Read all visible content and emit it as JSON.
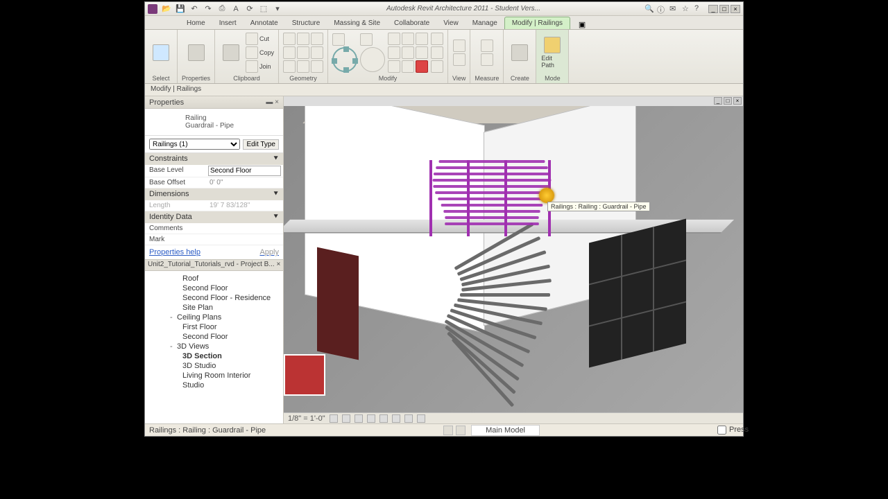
{
  "title": "Autodesk Revit Architecture 2011 - Student Vers...",
  "tabs": [
    "Home",
    "Insert",
    "Annotate",
    "Structure",
    "Massing & Site",
    "Collaborate",
    "View",
    "Manage",
    "Modify | Railings"
  ],
  "active_tab": 8,
  "ribbon": {
    "select": "Select",
    "properties": "Properties",
    "clipboard": "Clipboard",
    "clip_cut": "Cut",
    "clip_copy": "Copy",
    "clip_join": "Join",
    "geometry": "Geometry",
    "modify": "Modify",
    "view": "View",
    "measure": "Measure",
    "create": "Create",
    "mode": "Mode",
    "edit_path": "Edit Path"
  },
  "options_bar": "Modify | Railings",
  "properties": {
    "title": "Properties",
    "type1": "Railing",
    "type2": "Guardrail - Pipe",
    "filter": "Railings (1)",
    "edit_type": "Edit Type",
    "groups": {
      "constraints": "Constraints",
      "dimensions": "Dimensions",
      "identity": "Identity Data"
    },
    "base_level_k": "Base Level",
    "base_level_v": "Second Floor",
    "base_offset_k": "Base Offset",
    "base_offset_v": "0' 0\"",
    "length_k": "Length",
    "length_v": "19' 7 83/128\"",
    "comments_k": "Comments",
    "mark_k": "Mark",
    "help": "Properties help",
    "apply": "Apply"
  },
  "browser": {
    "title": "Unit2_Tutorial_Tutorials_rvd - Project B... ×",
    "items": [
      {
        "lvl": 2,
        "label": "Roof"
      },
      {
        "lvl": 2,
        "label": "Second Floor"
      },
      {
        "lvl": 2,
        "label": "Second Floor - Residence"
      },
      {
        "lvl": 2,
        "label": "Site Plan"
      },
      {
        "lvl": 1,
        "exp": "-",
        "label": "Ceiling Plans"
      },
      {
        "lvl": 2,
        "label": "First Floor"
      },
      {
        "lvl": 2,
        "label": "Second Floor"
      },
      {
        "lvl": 1,
        "exp": "-",
        "label": "3D Views"
      },
      {
        "lvl": 2,
        "bold": true,
        "label": "3D Section"
      },
      {
        "lvl": 2,
        "label": "3D Studio"
      },
      {
        "lvl": 2,
        "label": "Living Room Interior"
      },
      {
        "lvl": 2,
        "label": "Studio"
      }
    ]
  },
  "viewport": {
    "tooltip": "Railings : Railing : Guardrail - Pipe",
    "scale": "1/8\" = 1'-0\""
  },
  "status": {
    "left": "Railings : Railing : Guardrail - Pipe",
    "mid": "Main Model",
    "press": "Press"
  }
}
